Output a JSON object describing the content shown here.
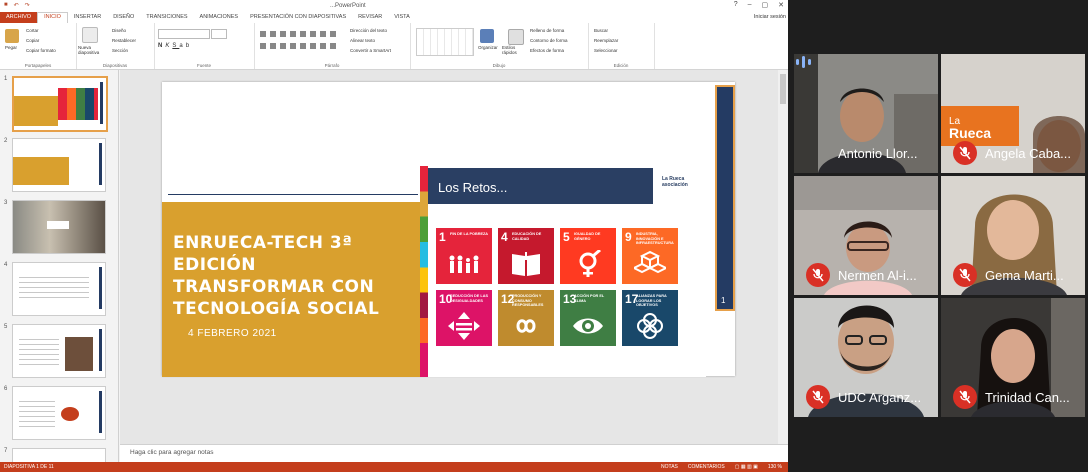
{
  "app": {
    "window_title": "...PowerPoint",
    "ribbon_tabs": [
      "ARCHIVO",
      "INICIO",
      "INSERTAR",
      "DISEÑO",
      "TRANSICIONES",
      "ANIMACIONES",
      "PRESENTACIÓN CON DIAPOSITIVAS",
      "REVISAR",
      "VISTA"
    ],
    "active_tab": "INICIO",
    "signin": "Iniciar sesión",
    "groups": {
      "clipboard": {
        "label": "Portapapeles",
        "paste": "Pegar",
        "cut": "Cortar",
        "copy": "Copiar",
        "format": "Copiar formato"
      },
      "slides": {
        "label": "Diapositivas",
        "new": "Nueva diapositiva",
        "layout": "Diseño",
        "reset": "Restablecer",
        "section": "Sección"
      },
      "font": {
        "label": "Fuente"
      },
      "paragraph": {
        "label": "Párrafo",
        "direction": "Dirección del texto",
        "align": "Alinear texto",
        "smartart": "Convertir a SmartArt"
      },
      "drawing": {
        "label": "Dibujo",
        "arrange": "Organizar",
        "quick_styles": "Estilos rápidos",
        "fill": "Relleno de forma",
        "outline": "Contorno de forma",
        "effects": "Efectos de forma"
      },
      "editing": {
        "label": "Edición",
        "find": "Buscar",
        "replace": "Reemplazar",
        "select": "Seleccionar"
      }
    },
    "thumbnails": [
      "1",
      "2",
      "3",
      "4",
      "5",
      "6",
      "7"
    ],
    "notes_placeholder": "Haga clic para agregar notas",
    "status_left": "DIAPOSITIVA 1 DE 11",
    "status_notes": "NOTAS",
    "status_comments": "COMENTARIOS",
    "zoom": "130 %"
  },
  "slide": {
    "title_lines": [
      "ENRUECA-TECH 3ª EDICIÓN",
      "TRANSFORMAR CON",
      "TECNOLOGÍA SOCIAL"
    ],
    "date": "4 FEBRERO 2021",
    "goals_heading": "Los Retos...",
    "logo": "La Rueca asociación",
    "page_number": "1",
    "goals": [
      {
        "num": "1",
        "label": "FIN DE LA POBREZA",
        "color": "#e5243b"
      },
      {
        "num": "4",
        "label": "EDUCACIÓN DE CALIDAD",
        "color": "#c5192d"
      },
      {
        "num": "5",
        "label": "IGUALDAD DE GÉNERO",
        "color": "#ff3a21"
      },
      {
        "num": "9",
        "label": "INDUSTRIA, INNOVACIÓN E INFRAESTRUCTURA",
        "color": "#fd6925"
      },
      {
        "num": "10",
        "label": "REDUCCIÓN DE LAS DESIGUALDADES",
        "color": "#dd1367"
      },
      {
        "num": "12",
        "label": "PRODUCCIÓN Y CONSUMO RESPONSABLES",
        "color": "#bf8b2e"
      },
      {
        "num": "13",
        "label": "ACCIÓN POR EL CLIMA",
        "color": "#3f7e44"
      },
      {
        "num": "17",
        "label": "ALIANZAS PARA LOGRAR LOS OBJETIVOS",
        "color": "#19486a"
      }
    ]
  },
  "meeting": {
    "participants": [
      {
        "name": "Antonio Llor...",
        "muted": false
      },
      {
        "name": "Angela Caba...",
        "muted": true
      },
      {
        "name": "Nermen Al-i...",
        "muted": true
      },
      {
        "name": "Gema Marti...",
        "muted": true
      },
      {
        "name": "UDC Arganz...",
        "muted": true
      },
      {
        "name": "Trinidad Can...",
        "muted": true
      }
    ]
  }
}
